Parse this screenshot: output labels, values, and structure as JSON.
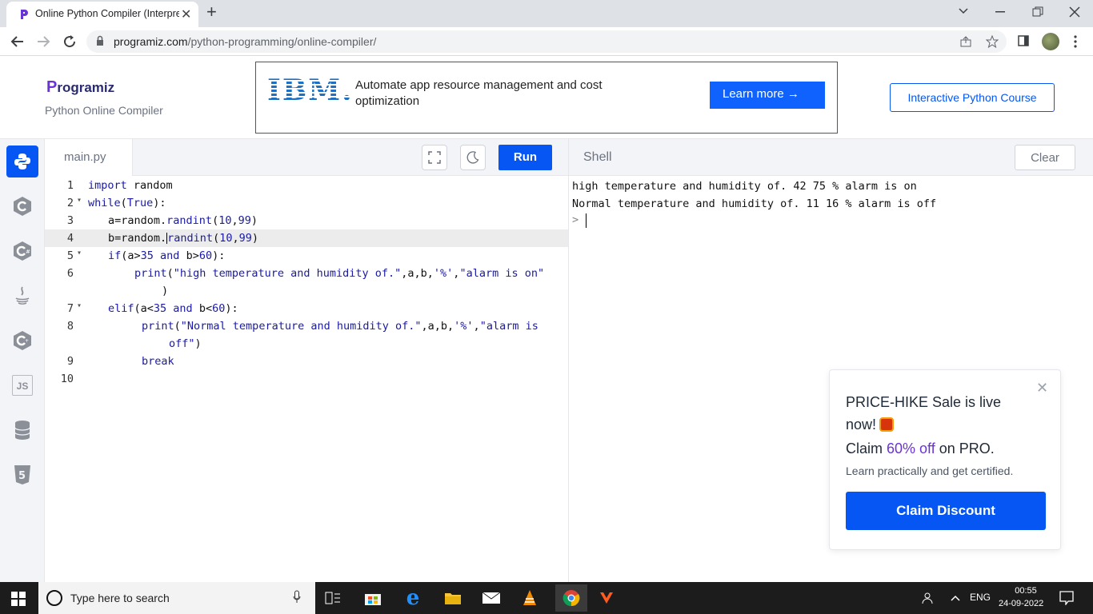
{
  "browser": {
    "tab_title": "Online Python Compiler (Interpre",
    "tab_close": "✕",
    "new_tab": "+",
    "url_host": "programiz.com",
    "url_path": "/python-programming/online-compiler/"
  },
  "header": {
    "logo_p": "P",
    "logo_rest": "rogramiz",
    "subtitle": "Python Online Compiler",
    "ad": {
      "brand": "IBM.",
      "text": "Automate app resource management and cost optimization",
      "button": "Learn more  →"
    },
    "course_button": "Interactive Python Course"
  },
  "rail": {
    "items": [
      "python-icon",
      "c-icon",
      "csharp-icon",
      "java-icon",
      "cpp-icon",
      "javascript-icon",
      "sql-icon",
      "html5-icon"
    ],
    "js_label": "JS"
  },
  "editor": {
    "file_name": "main.py",
    "run_label": "Run",
    "lines": [
      {
        "n": "1"
      },
      {
        "n": "2"
      },
      {
        "n": "3"
      },
      {
        "n": "4"
      },
      {
        "n": "5"
      },
      {
        "n": "6"
      },
      {
        "n": "",
        "wrap": true
      },
      {
        "n": "7"
      },
      {
        "n": "8"
      },
      {
        "n": "",
        "wrap": true
      },
      {
        "n": "9"
      },
      {
        "n": "10"
      }
    ],
    "code": {
      "l1_kw": "import",
      "l1_rest": " random",
      "l2_kw": "while",
      "l2_a": "(",
      "l2_true": "True",
      "l2_b": "):",
      "l3_a": "a=random.",
      "l3_fn": "randint",
      "l3_b": "(",
      "l3_n1": "10",
      "l3_c": ",",
      "l3_n2": "99",
      "l3_d": ")",
      "l4_a": "b=random.",
      "l4_fn": "randint",
      "l4_b": "(",
      "l4_n1": "10",
      "l4_c": ",",
      "l4_n2": "99",
      "l4_d": ")",
      "l5_kw": "if",
      "l5_a": "(a>",
      "l5_n1": "35",
      "l5_and": " and ",
      "l5_b": "b>",
      "l5_n2": "60",
      "l5_c": "):",
      "l6_fn": "print",
      "l6_a": "(",
      "l6_str": "\"high temperature and humidity of.\"",
      "l6_b": ",a,b,",
      "l6_pct": "'%'",
      "l6_c": ",",
      "l6_str2": "\"alarm is on\"",
      "l6w": ")",
      "l7_kw": "elif",
      "l7_a": "(a<",
      "l7_n1": "35",
      "l7_and": " and ",
      "l7_b": "b<",
      "l7_n2": "60",
      "l7_c": "):",
      "l8_fn": "print",
      "l8_a": "(",
      "l8_str": "\"Normal temperature and humidity of.\"",
      "l8_b": ",a,b,",
      "l8_pct": "'%'",
      "l8_c": ",",
      "l8_str2": "\"alarm is",
      "l8w_str": "off\"",
      "l8w_b": ")",
      "l9_kw": "break"
    }
  },
  "shell": {
    "title": "Shell",
    "clear_label": "Clear",
    "output": [
      "high temperature and humidity of. 42 75 % alarm is on",
      "Normal temperature and humidity of. 11 16 % alarm is off"
    ],
    "prompt": ">"
  },
  "promo": {
    "close": "✕",
    "headline": "PRICE-HIKE Sale is live now!",
    "claim_prefix": "Claim ",
    "claim_highlight": "60% off",
    "claim_suffix": " on PRO.",
    "subtext": "Learn practically and get certified.",
    "button": "Claim Discount"
  },
  "taskbar": {
    "search_placeholder": "Type here to search",
    "lang": "ENG",
    "time": "00:55",
    "date": "24-09-2022"
  },
  "colors": {
    "accent": "#0556f3",
    "promo_highlight": "#6a33d6",
    "ibm_blue": "#1f70c1"
  }
}
